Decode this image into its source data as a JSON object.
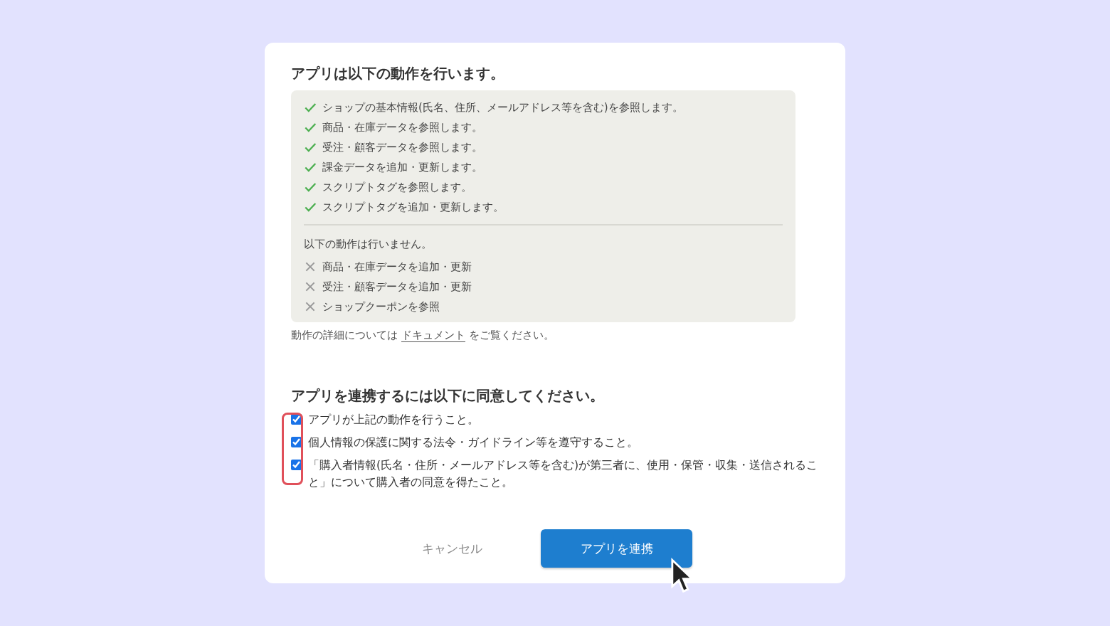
{
  "permissions": {
    "title": "アプリは以下の動作を行います。",
    "allowed": [
      "ショップの基本情報(氏名、住所、メールアドレス等を含む)を参照します。",
      "商品・在庫データを参照します。",
      "受注・顧客データを参照します。",
      "課金データを追加・更新します。",
      "スクリプトタグを参照します。",
      "スクリプトタグを追加・更新します。"
    ],
    "denied_title": "以下の動作は行いません。",
    "denied": [
      "商品・在庫データを追加・更新",
      "受注・顧客データを追加・更新",
      "ショップクーポンを参照"
    ],
    "note_before": "動作の詳細については",
    "note_link": "ドキュメント",
    "note_after": "をご覧ください。"
  },
  "consent": {
    "title": "アプリを連携するには以下に同意してください。",
    "items": [
      {
        "label": "アプリが上記の動作を行うこと。",
        "checked": true
      },
      {
        "label": "個人情報の保護に関する法令・ガイドライン等を遵守すること。",
        "checked": true
      },
      {
        "label": "「購入者情報(氏名・住所・メールアドレス等を含む)が第三者に、使用・保管・収集・送信されること」について購入者の同意を得たこと。",
        "checked": true
      }
    ]
  },
  "buttons": {
    "cancel": "キャンセル",
    "confirm": "アプリを連携"
  }
}
